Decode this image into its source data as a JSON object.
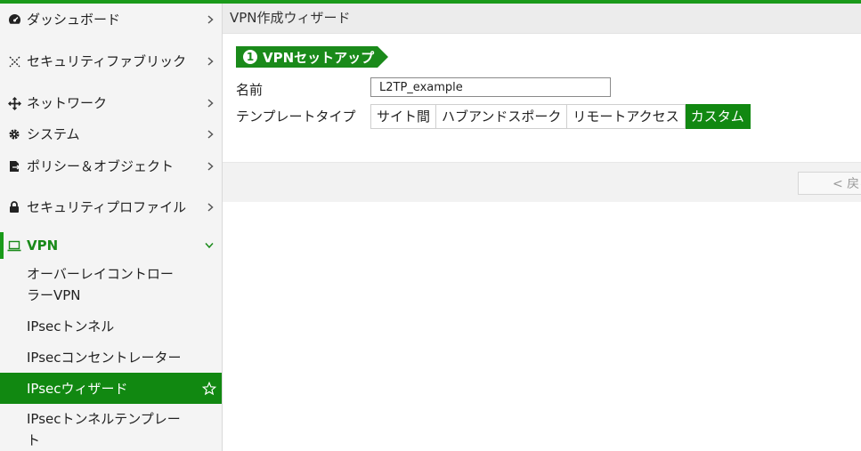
{
  "sidebar": {
    "items": [
      {
        "label": "ダッシュボード",
        "icon": "dashboard-icon"
      },
      {
        "label": "セキュリティファブリック",
        "icon": "security-fabric-icon"
      },
      {
        "label": "ネットワーク",
        "icon": "network-icon"
      },
      {
        "label": "システム",
        "icon": "gear-icon"
      },
      {
        "label": "ポリシー＆オブジェクト",
        "icon": "policy-icon"
      },
      {
        "label": "セキュリティプロファイル",
        "icon": "lock-icon"
      },
      {
        "label": "VPN",
        "icon": "laptop-icon"
      }
    ],
    "vpn_subitems": [
      {
        "label": "オーバーレイコントローラーVPN"
      },
      {
        "label": "IPsecトンネル"
      },
      {
        "label": "IPsecコンセントレーター"
      },
      {
        "label": "IPsecウィザード"
      },
      {
        "label": "IPsecトンネルテンプレート"
      }
    ]
  },
  "header": {
    "title": "VPN作成ウィザード"
  },
  "wizard": {
    "step_number": "1",
    "step_label": "VPNセットアップ",
    "name_label": "名前",
    "name_value": "L2TP_example",
    "template_type_label": "テンプレートタイプ",
    "template_types": [
      {
        "label": "サイト間",
        "selected": false
      },
      {
        "label": "ハブアンドスポーク",
        "selected": false
      },
      {
        "label": "リモートアクセス",
        "selected": false
      },
      {
        "label": "カスタム",
        "selected": true
      }
    ],
    "back_button": "< 戻る"
  },
  "colors": {
    "accent": "#118811",
    "accent_light": "#1a9a1a"
  }
}
